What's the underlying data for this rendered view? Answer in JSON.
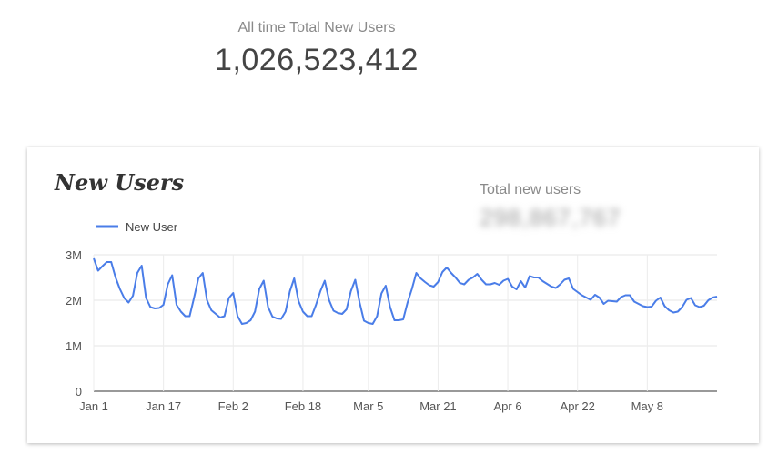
{
  "kpi": {
    "label": "All time Total New Users",
    "value": "1,026,523,412"
  },
  "card": {
    "title": "New Users",
    "scorecard": {
      "label": "Total new users",
      "value": "298,867,767"
    }
  },
  "chart_data": {
    "type": "line",
    "title": "New Users",
    "legend": "top-left",
    "grid": true,
    "x": [
      0,
      1,
      2,
      3,
      4,
      5,
      6,
      7,
      8,
      9,
      10,
      11,
      12,
      13,
      14,
      15,
      16,
      17,
      18,
      19,
      20,
      21,
      22,
      23,
      24,
      25,
      26,
      27,
      28,
      29,
      30,
      31,
      32,
      33,
      34,
      35,
      36,
      37,
      38,
      39,
      40,
      41,
      42,
      43,
      44,
      45,
      46,
      47,
      48,
      49,
      50,
      51,
      52,
      53,
      54,
      55,
      56,
      57,
      58,
      59,
      60,
      61,
      62,
      63,
      64,
      65,
      66,
      67,
      68,
      69,
      70,
      71,
      72,
      73,
      74,
      75,
      76,
      77,
      78,
      79,
      80,
      81,
      82,
      83,
      84,
      85,
      86,
      87,
      88,
      89,
      90,
      91,
      92,
      93,
      94,
      95,
      96,
      97,
      98,
      99,
      100,
      101,
      102,
      103,
      104,
      105,
      106,
      107,
      108,
      109,
      110,
      111,
      112,
      113,
      114,
      115,
      116,
      117,
      118,
      119,
      120,
      121,
      122,
      123,
      124,
      125,
      126,
      127,
      128,
      129,
      130,
      131,
      132,
      133,
      134,
      135,
      136,
      137,
      138,
      139,
      140,
      141,
      142,
      143
    ],
    "xticks": [
      {
        "i": 0,
        "label": "Jan 1"
      },
      {
        "i": 16,
        "label": "Jan 17"
      },
      {
        "i": 32,
        "label": "Feb 2"
      },
      {
        "i": 48,
        "label": "Feb 18"
      },
      {
        "i": 63,
        "label": "Mar 5"
      },
      {
        "i": 79,
        "label": "Mar 21"
      },
      {
        "i": 95,
        "label": "Apr 6"
      },
      {
        "i": 111,
        "label": "Apr 22"
      },
      {
        "i": 127,
        "label": "May 8"
      }
    ],
    "yticks": [
      {
        "v": 0,
        "label": "0"
      },
      {
        "v": 1000000,
        "label": "1M"
      },
      {
        "v": 2000000,
        "label": "2M"
      },
      {
        "v": 3000000,
        "label": "3M"
      }
    ],
    "ylim": [
      0,
      3000000
    ],
    "series": [
      {
        "name": "New User",
        "color": "#4a7de8",
        "values": [
          2920000,
          2650000,
          2750000,
          2840000,
          2840000,
          2500000,
          2250000,
          2050000,
          1950000,
          2100000,
          2600000,
          2760000,
          2050000,
          1850000,
          1820000,
          1830000,
          1900000,
          2350000,
          2550000,
          1900000,
          1750000,
          1650000,
          1650000,
          2050000,
          2480000,
          2600000,
          2000000,
          1780000,
          1700000,
          1620000,
          1650000,
          2050000,
          2160000,
          1650000,
          1480000,
          1500000,
          1560000,
          1750000,
          2250000,
          2430000,
          1850000,
          1640000,
          1600000,
          1590000,
          1750000,
          2200000,
          2480000,
          1980000,
          1750000,
          1650000,
          1650000,
          1900000,
          2200000,
          2430000,
          2000000,
          1770000,
          1720000,
          1700000,
          1800000,
          2200000,
          2450000,
          1950000,
          1550000,
          1500000,
          1480000,
          1650000,
          2150000,
          2320000,
          1850000,
          1560000,
          1560000,
          1580000,
          1950000,
          2250000,
          2600000,
          2480000,
          2400000,
          2330000,
          2300000,
          2400000,
          2620000,
          2720000,
          2600000,
          2500000,
          2380000,
          2350000,
          2450000,
          2500000,
          2580000,
          2450000,
          2350000,
          2350000,
          2380000,
          2340000,
          2430000,
          2470000,
          2300000,
          2240000,
          2420000,
          2280000,
          2530000,
          2500000,
          2500000,
          2420000,
          2360000,
          2300000,
          2270000,
          2350000,
          2450000,
          2480000,
          2250000,
          2180000,
          2110000,
          2060000,
          2010000,
          2120000,
          2060000,
          1920000,
          1990000,
          1980000,
          1970000,
          2070000,
          2110000,
          2110000,
          1970000,
          1920000,
          1870000,
          1850000,
          1860000,
          1990000,
          2060000,
          1870000,
          1780000,
          1730000,
          1750000,
          1850000,
          2010000,
          2050000,
          1890000,
          1850000,
          1880000,
          2000000,
          2060000,
          2080000
        ]
      }
    ]
  }
}
